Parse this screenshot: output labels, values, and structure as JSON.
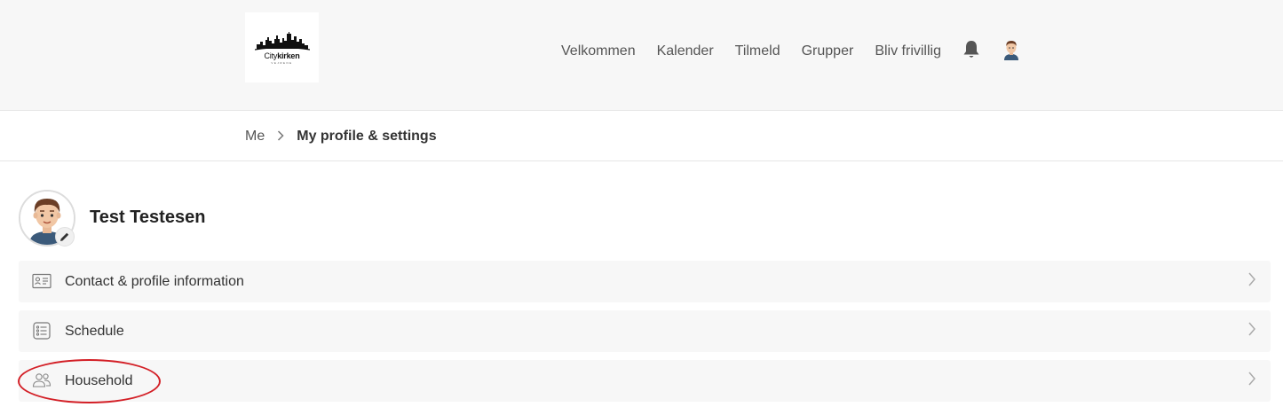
{
  "header": {
    "logo": {
      "text_city": "City",
      "text_kirken": "kirken",
      "sub": "VEJRENE"
    },
    "nav": [
      "Velkommen",
      "Kalender",
      "Tilmeld",
      "Grupper",
      "Bliv frivillig"
    ],
    "icons": {
      "notifications": "bell-icon",
      "account": "user-avatar-icon"
    }
  },
  "breadcrumb": {
    "parent": "Me",
    "separator": ">",
    "current": "My profile & settings"
  },
  "profile": {
    "name": "Test Testesen",
    "edit_icon": "pencil-icon"
  },
  "rows": [
    {
      "label": "Contact & profile information",
      "icon": "id-card-icon"
    },
    {
      "label": "Schedule",
      "icon": "list-icon"
    },
    {
      "label": "Household",
      "icon": "people-icon"
    }
  ],
  "colors": {
    "header_bg": "#f7f7f7",
    "row_bg": "#f7f7f7",
    "highlight": "#d31f26"
  }
}
